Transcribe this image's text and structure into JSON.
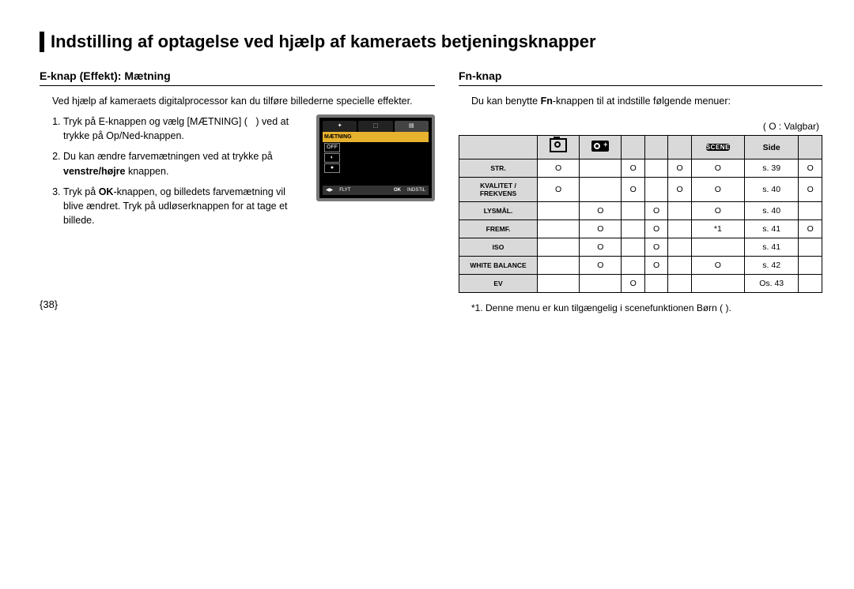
{
  "section_title": "Indstilling af optagelse ved hjælp af kameraets betjeningsknapper",
  "left": {
    "heading": "E-knap (Effekt):  Mætning",
    "intro": "Ved hjælp af kameraets digitalprocessor kan du tilføre billederne specielle effekter.",
    "steps": [
      {
        "pre": "Tryk på E-knappen og vælg [MÆTNING] (",
        "mid": "",
        "post": ") ved at trykke på Op/Ned-knappen."
      },
      {
        "pre": "Du kan ændre farvemætningen ved at trykke på ",
        "bold": "venstre/højre",
        "post": " knappen."
      },
      {
        "pre": "Tryk på ",
        "bold": "OK",
        "post": "-knappen, og billedets farvemætning vil blive ændret. Tryk på udløserknappen for at tage et billede."
      }
    ],
    "lcd": {
      "title": "MÆTNING",
      "off": "OFF",
      "move_label": "FLYT",
      "ok_label": "OK",
      "set_label": "INDSTIL"
    }
  },
  "right": {
    "heading": "Fn-knap",
    "intro_pre": "Du kan benytte ",
    "intro_bold": "Fn",
    "intro_post": "-knappen til at indstille følgende menuer:",
    "legend": "(  O :  Valgbar)",
    "table": {
      "side_header": "Side",
      "scene_label": "SCENE",
      "rows": [
        {
          "label": "STR.",
          "c1": "O",
          "c2": "",
          "c3": "O",
          "c4": "",
          "c5": "O",
          "c6": "O",
          "side": "s. 39",
          "c7": "O"
        },
        {
          "label": "KVALITET / FREKVENS",
          "c1": "O",
          "c2": "",
          "c3": "O",
          "c4": "",
          "c5": "O",
          "c6": "O",
          "side": "s. 40",
          "c7": "O"
        },
        {
          "label": "LYSMÅL.",
          "c1": "",
          "c2": "O",
          "c3": "",
          "c4": "O",
          "c5": "",
          "c6": "O",
          "side": "s. 40",
          "c7": ""
        },
        {
          "label": "FREMF.",
          "c1": "",
          "c2": "O",
          "c3": "",
          "c4": "O",
          "c5": "",
          "c6": "*1",
          "side": "s. 41",
          "c7": "O"
        },
        {
          "label": "ISO",
          "c1": "",
          "c2": "O",
          "c3": "",
          "c4": "O",
          "c5": "",
          "c6": "",
          "side": "s. 41",
          "c7": ""
        },
        {
          "label": "WHITE BALANCE",
          "c1": "",
          "c2": "O",
          "c3": "",
          "c4": "O",
          "c5": "",
          "c6": "O",
          "side": "s. 42",
          "c7": ""
        },
        {
          "label": "EV",
          "c1": "",
          "c2": "",
          "c3": "O",
          "c4": "",
          "c5": "",
          "c6": "",
          "side": "Os. 43",
          "c7": ""
        }
      ]
    },
    "footnote": "*1. Denne menu er kun tilgængelig i scenefunktionen Børn (      )."
  },
  "page_number": "{38}"
}
